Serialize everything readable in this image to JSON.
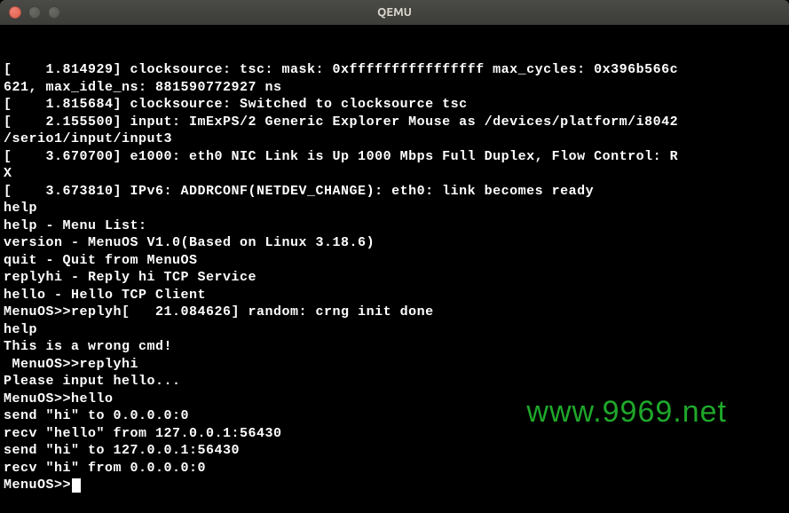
{
  "window": {
    "title": "QEMU"
  },
  "terminal": {
    "lines": [
      "[    1.814929] clocksource: tsc: mask: 0xffffffffffffffff max_cycles: 0x396b566c",
      "621, max_idle_ns: 881590772927 ns",
      "[    1.815684] clocksource: Switched to clocksource tsc",
      "[    2.155500] input: ImExPS/2 Generic Explorer Mouse as /devices/platform/i8042",
      "/serio1/input/input3",
      "[    3.670700] e1000: eth0 NIC Link is Up 1000 Mbps Full Duplex, Flow Control: R",
      "X",
      "[    3.673810] IPv6: ADDRCONF(NETDEV_CHANGE): eth0: link becomes ready",
      "help",
      "help - Menu List:",
      "version - MenuOS V1.0(Based on Linux 3.18.6)",
      "quit - Quit from MenuOS",
      "replyhi - Reply hi TCP Service",
      "hello - Hello TCP Client",
      "MenuOS>>replyh[   21.084626] random: crng init done",
      "help",
      "This is a wrong cmd!",
      " MenuOS>>replyhi",
      "Please input hello...",
      "MenuOS>>hello",
      "send \"hi\" to 0.0.0.0:0",
      "recv \"hello\" from 127.0.0.1:56430",
      "send \"hi\" to 127.0.0.1:56430",
      "recv \"hi\" from 0.0.0.0:0"
    ],
    "prompt": "MenuOS>>"
  },
  "watermark": "www.9969.net"
}
